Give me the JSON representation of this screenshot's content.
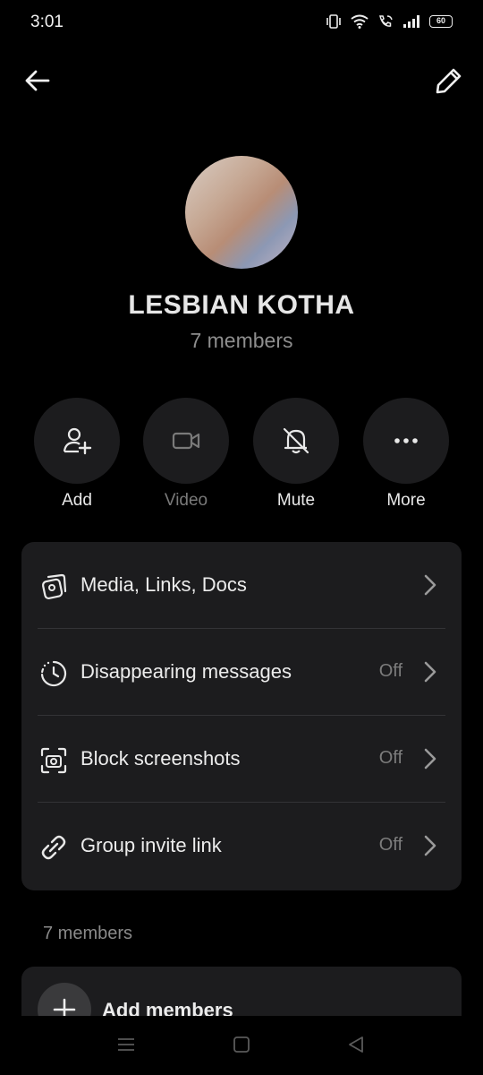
{
  "status_bar": {
    "time": "3:01",
    "battery": "60"
  },
  "topbar": {
    "back_icon": "arrow-left-icon",
    "edit_icon": "pencil-icon"
  },
  "group": {
    "name": "LESBIAN KOTHA",
    "members_text": "7 members"
  },
  "actions": [
    {
      "label": "Add",
      "icon": "add-user-icon",
      "enabled": true
    },
    {
      "label": "Video",
      "icon": "video-icon",
      "enabled": false
    },
    {
      "label": "Mute",
      "icon": "bell-off-icon",
      "enabled": true
    },
    {
      "label": "More",
      "icon": "more-icon",
      "enabled": true
    }
  ],
  "settings": [
    {
      "title": "Media, Links, Docs",
      "value": "",
      "icon": "media-icon"
    },
    {
      "title": "Disappearing messages",
      "value": "Off",
      "icon": "timer-icon"
    },
    {
      "title": "Block screenshots",
      "value": "Off",
      "icon": "screenshot-icon"
    },
    {
      "title": "Group invite link",
      "value": "Off",
      "icon": "link-icon"
    }
  ],
  "members_section": {
    "label": "7 members",
    "add_members": "Add members"
  },
  "colors": {
    "background": "#000000",
    "card": "#1c1c1e",
    "muted": "#8e8e8e"
  }
}
